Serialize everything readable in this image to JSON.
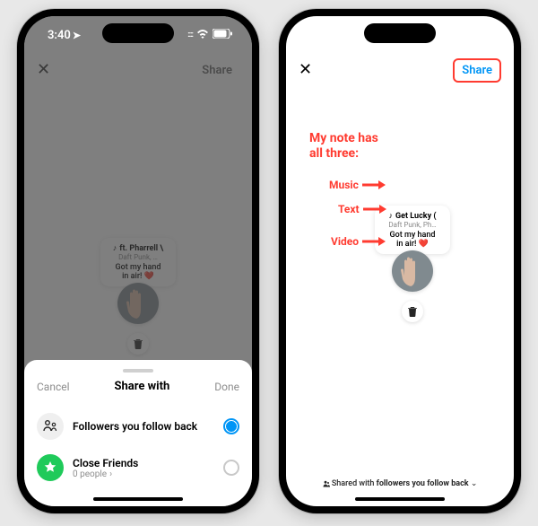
{
  "status": {
    "time": "3:40",
    "nav_arrow": "➤"
  },
  "left": {
    "share_dimmed": "Share",
    "sheet": {
      "cancel": "Cancel",
      "title": "Share with",
      "done": "Done",
      "options": [
        {
          "label": "Followers you follow back",
          "selected": true,
          "sub": ""
        },
        {
          "label": "Close Friends",
          "sub": "0 people",
          "chevron": "›",
          "selected": false
        }
      ]
    }
  },
  "right": {
    "share": "Share",
    "annotation_title_line1": "My note has",
    "annotation_title_line2": "all three:",
    "labels": {
      "music": "Music",
      "text": "Text",
      "video": "Video"
    },
    "shared_with_prefix": "Shared with ",
    "shared_with_value": "followers you follow back",
    "shared_with_chevron": "⌄"
  },
  "note": {
    "music_title": "Get Lucky (",
    "music_prefix": "ft. Pharrell \\",
    "music_artist": "Daft Punk, Ph…",
    "music_artist_short": "Daft Punk, …",
    "text_line1": "Got my hand",
    "text_line2": "in air!",
    "heart": "❤️"
  },
  "icons": {
    "followback": "people-swap-icon",
    "closefriends": "star-icon",
    "trash": "trash-icon",
    "lock": "lock-icon",
    "music_note": "music-note-icon"
  }
}
